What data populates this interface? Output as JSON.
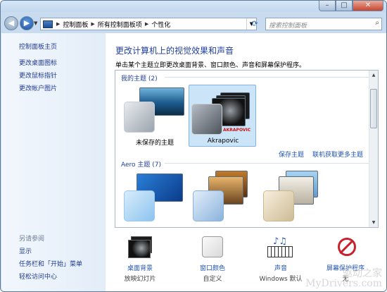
{
  "window": {
    "min_glyph": "–",
    "max_glyph": "□",
    "close_glyph": "✕"
  },
  "nav": {
    "back_glyph": "◀",
    "forward_glyph": "▶",
    "history_glyph": "▼",
    "refresh_glyph": "⟳"
  },
  "address": {
    "crumbs": [
      "控制面板",
      "所有控制面板项",
      "个性化"
    ],
    "sep": "▶",
    "dropdown_glyph": "▼"
  },
  "search": {
    "placeholder": "搜索控制面板",
    "icon": "search-icon",
    "glyph": "⌕"
  },
  "sidebar": {
    "home": "控制面板主页",
    "links": [
      "更改桌面图标",
      "更改鼠标指针",
      "更改帐户图片"
    ],
    "see_also_title": "另请参阅",
    "see_also": [
      "显示",
      "任务栏和「开始」菜单",
      "轻松访问中心"
    ]
  },
  "main": {
    "heading": "更改计算机上的视觉效果和声音",
    "description": "单击某个主题立即更改桌面背景、窗口颜色、声音和屏幕保护程序。",
    "my_themes": {
      "title": "我的主题 (2)",
      "items": [
        {
          "label": "未保存的主题",
          "selected": false
        },
        {
          "label": "Akrapovic",
          "selected": true
        }
      ],
      "save_link": "保存主题",
      "online_link": "联机获取更多主题",
      "brand_text": "AKRAPOVIC"
    },
    "aero_themes": {
      "title": "Aero 主题 (7)"
    },
    "scroll": {
      "up": "▲",
      "down": "▼"
    }
  },
  "bottom": [
    {
      "label": "桌面背景",
      "sub": "放映幻灯片",
      "icon": "desktop-background-icon"
    },
    {
      "label": "窗口颜色",
      "sub": "自定义",
      "icon": "window-color-icon"
    },
    {
      "label": "声音",
      "sub": "Windows 默认",
      "icon": "sound-icon"
    },
    {
      "label": "屏幕保护程序",
      "sub": "无",
      "icon": "screensaver-icon"
    }
  ],
  "watermark": {
    "line1": "驱动之家",
    "line2": "MyDrivers.com"
  },
  "colors": {
    "link": "#1f54b3",
    "heading": "#1f3e9b",
    "selection": "#cce4f7"
  }
}
